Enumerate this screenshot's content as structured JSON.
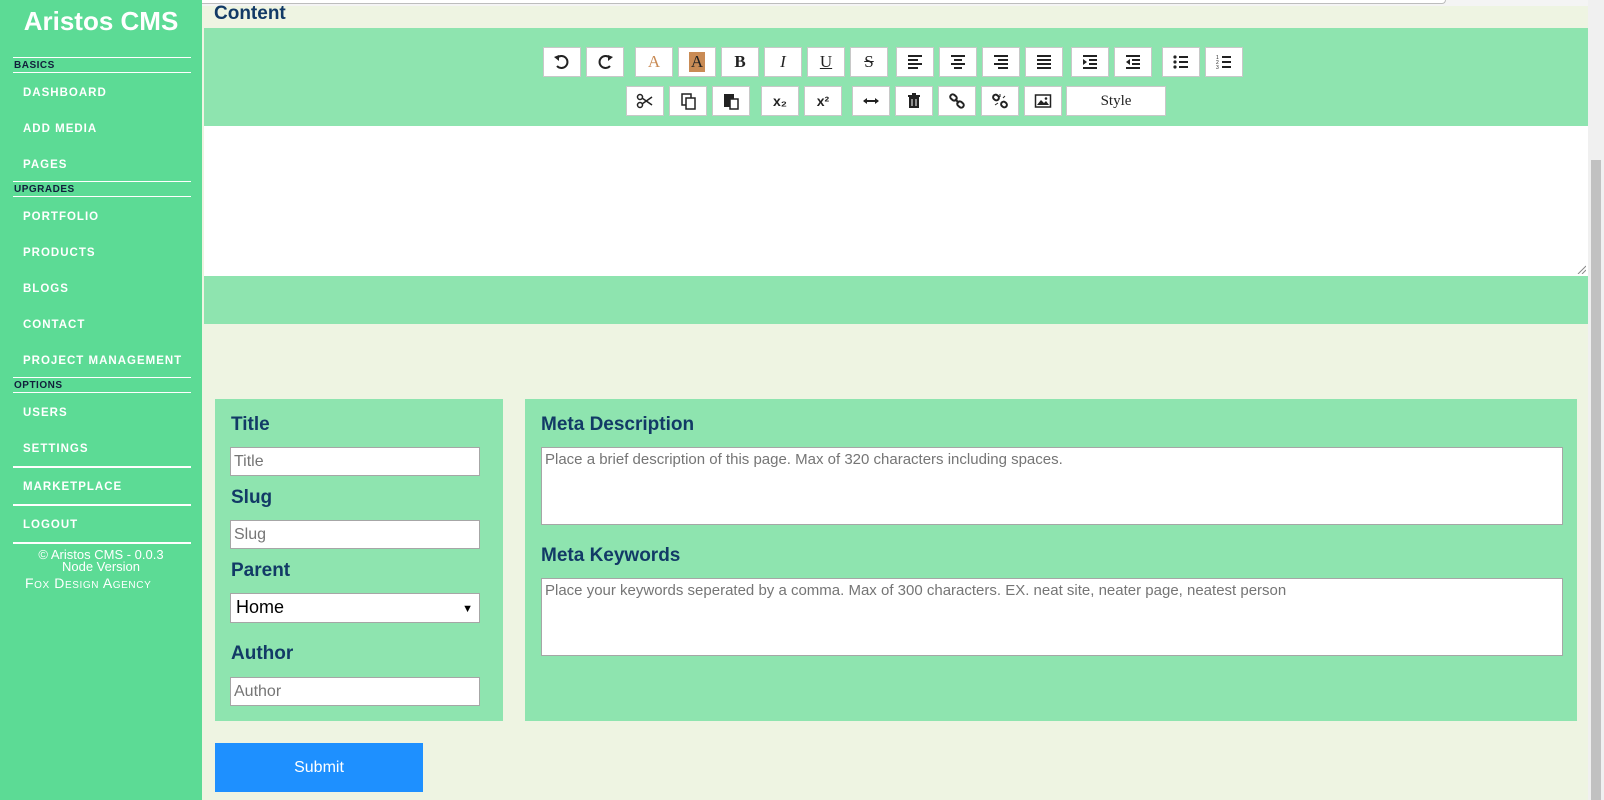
{
  "app": {
    "title": "Aristos CMS"
  },
  "sidebar": {
    "sections": [
      {
        "label": "BASICS"
      },
      {
        "label": "UPGRADES"
      },
      {
        "label": "OPTIONS"
      }
    ],
    "items": [
      {
        "label": "DASHBOARD"
      },
      {
        "label": "ADD MEDIA"
      },
      {
        "label": "PAGES"
      },
      {
        "label": "PORTFOLIO"
      },
      {
        "label": "PRODUCTS"
      },
      {
        "label": "BLOGS"
      },
      {
        "label": "CONTACT"
      },
      {
        "label": "PROJECT MANAGEMENT"
      },
      {
        "label": "USERS"
      },
      {
        "label": "SETTINGS"
      },
      {
        "label": "MARKETPLACE"
      },
      {
        "label": "LOGOUT"
      }
    ],
    "footer": {
      "copyright": "© Aristos CMS - 0.0.3",
      "version": "Node Version",
      "agency": "Fox Design Agency"
    }
  },
  "editor": {
    "section_title": "Content",
    "toolbar": {
      "row1": [
        {
          "icon": "undo-icon"
        },
        {
          "icon": "redo-icon"
        },
        {
          "icon": "font-color-icon",
          "glyph": "A",
          "color": "#c98b55"
        },
        {
          "icon": "highlight-color-icon",
          "glyph": "A",
          "color": "#c98b55"
        },
        {
          "icon": "bold-icon",
          "glyph": "B"
        },
        {
          "icon": "italic-icon",
          "glyph": "I"
        },
        {
          "icon": "underline-icon",
          "glyph": "U"
        },
        {
          "icon": "strikethrough-icon",
          "glyph": "S"
        },
        {
          "icon": "align-left-icon"
        },
        {
          "icon": "align-center-icon"
        },
        {
          "icon": "align-right-icon"
        },
        {
          "icon": "align-justify-icon"
        },
        {
          "icon": "indent-icon"
        },
        {
          "icon": "outdent-icon"
        },
        {
          "icon": "bullet-list-icon"
        },
        {
          "icon": "numbered-list-icon"
        }
      ],
      "row2": [
        {
          "icon": "cut-icon"
        },
        {
          "icon": "copy-icon"
        },
        {
          "icon": "paste-icon"
        },
        {
          "icon": "subscript-icon",
          "glyph": "x₂"
        },
        {
          "icon": "superscript-icon",
          "glyph": "x²"
        },
        {
          "icon": "horizontal-rule-icon"
        },
        {
          "icon": "trash-icon"
        },
        {
          "icon": "link-icon"
        },
        {
          "icon": "unlink-icon"
        },
        {
          "icon": "image-icon"
        }
      ],
      "style_label": "Style"
    }
  },
  "form": {
    "title": {
      "label": "Title",
      "placeholder": "Title"
    },
    "slug": {
      "label": "Slug",
      "placeholder": "Slug"
    },
    "parent": {
      "label": "Parent",
      "value": "Home"
    },
    "author": {
      "label": "Author",
      "placeholder": "Author"
    },
    "meta_description": {
      "label": "Meta Description",
      "placeholder": "Place a brief description of this page. Max of 320 characters including spaces."
    },
    "meta_keywords": {
      "label": "Meta Keywords",
      "placeholder": "Place your keywords seperated by a comma. Max of 300 characters. EX. neat site, neater page, neatest person"
    },
    "submit_label": "Submit"
  },
  "colors": {
    "sidebar_bg": "#5cdb95",
    "panel_bg": "#8ee4af",
    "page_bg": "#eef4e2",
    "heading_text": "#123a66",
    "submit_bg": "#1e90ff"
  }
}
